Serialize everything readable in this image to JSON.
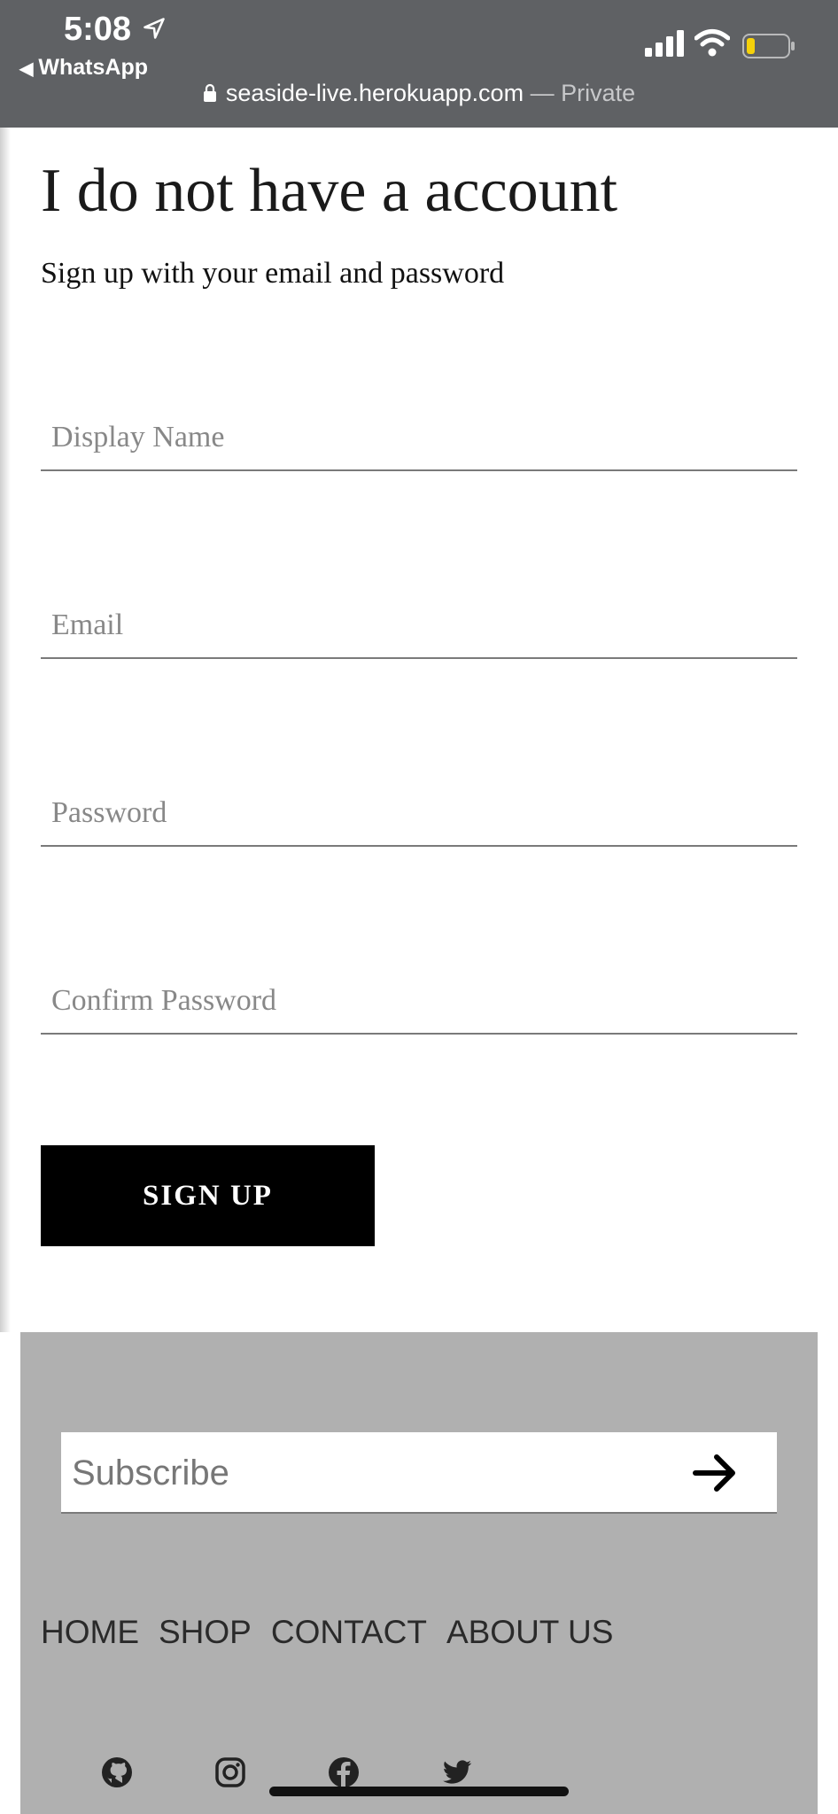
{
  "status_bar": {
    "time": "5:08",
    "back_app": "WhatsApp",
    "url": "seaside-live.herokuapp.com",
    "private_label": "— Private"
  },
  "signup": {
    "title": "I do not have a account",
    "subtitle": "Sign up with your email and password",
    "fields": [
      {
        "placeholder": "Display Name",
        "value": ""
      },
      {
        "placeholder": "Email",
        "value": ""
      },
      {
        "placeholder": "Password",
        "value": ""
      },
      {
        "placeholder": "Confirm Password",
        "value": ""
      }
    ],
    "button_label": "SIGN UP"
  },
  "footer": {
    "subscribe_placeholder": "Subscribe",
    "nav": [
      "HOME",
      "SHOP",
      "CONTACT",
      "ABOUT US"
    ],
    "social_icons": [
      "github-icon",
      "instagram-icon",
      "facebook-icon",
      "twitter-icon"
    ]
  },
  "colors": {
    "status_bar_bg": "#5f6164",
    "footer_bg": "#b0b0b0",
    "button_bg": "#000000",
    "battery_fill": "#f5d10a"
  }
}
